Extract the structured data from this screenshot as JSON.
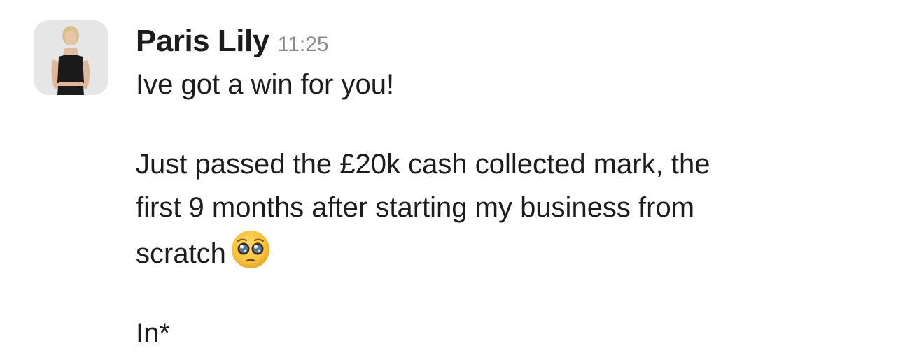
{
  "message": {
    "author": "Paris Lily",
    "timestamp": "11:25",
    "paragraphs": {
      "p1": "Ive got a win for you!",
      "p2_line1": "Just passed the £20k cash collected mark, the",
      "p2_line2": "first 9 months after starting my business from",
      "p2_line3": "scratch",
      "p3": "In*"
    },
    "emoji": {
      "icon": "pleading-face-emoji"
    },
    "colors": {
      "text": "#1d1c1d",
      "timestamp": "#8a8a8c",
      "background": "#ffffff"
    }
  }
}
